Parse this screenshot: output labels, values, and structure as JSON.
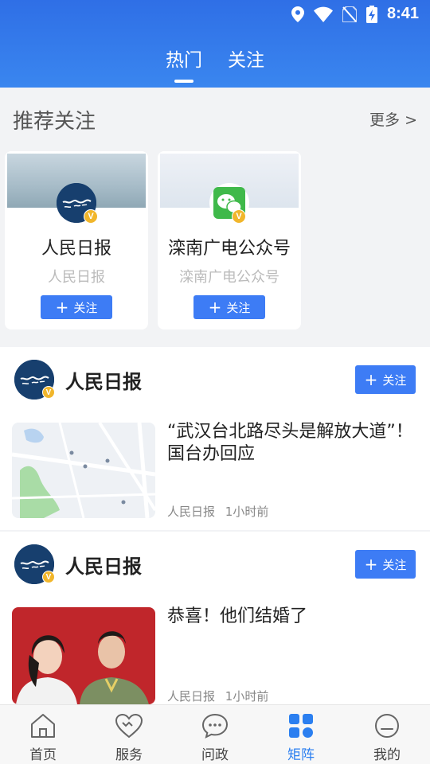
{
  "status_bar": {
    "time": "8:41"
  },
  "header": {
    "tabs": [
      {
        "label": "热门",
        "active": true
      },
      {
        "label": "关注",
        "active": false
      }
    ]
  },
  "recommend": {
    "title": "推荐关注",
    "more": "更多 >",
    "cards": [
      {
        "name": "人民日报",
        "subtitle": "人民日报",
        "follow_label": "关注",
        "avatar_text": "人民日报"
      },
      {
        "name": "滦南广电公众号",
        "subtitle": "滦南广电公众号",
        "follow_label": "关注"
      }
    ]
  },
  "feed": [
    {
      "source": "人民日报",
      "avatar_text": "人民日报",
      "follow_label": "关注",
      "title": "“武汉台北路尽头是解放大道”！国台办回应",
      "meta_source": "人民日报",
      "meta_time": "1小时前"
    },
    {
      "source": "人民日报",
      "avatar_text": "人民日报",
      "follow_label": "关注",
      "title": "恭喜！他们结婚了",
      "meta_source": "人民日报",
      "meta_time": "1小时前"
    }
  ],
  "bottom_nav": [
    {
      "label": "首页",
      "icon": "home-icon",
      "active": false
    },
    {
      "label": "服务",
      "icon": "heart-icon",
      "active": false
    },
    {
      "label": "问政",
      "icon": "chat-bubble-icon",
      "active": false
    },
    {
      "label": "矩阵",
      "icon": "grid-icon",
      "active": true
    },
    {
      "label": "我的",
      "icon": "profile-icon",
      "active": false
    }
  ],
  "colors": {
    "primary": "#3d7cf5",
    "header": "#2f6fe6",
    "badge": "#f1b62b",
    "nav_active": "#2b7ff0"
  }
}
